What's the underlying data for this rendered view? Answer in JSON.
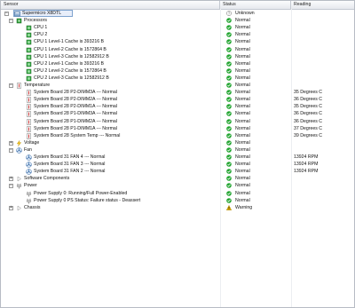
{
  "columns": {
    "sensor": "Sensor",
    "status": "Status",
    "reading": "Reading"
  },
  "colors": {
    "ok": "#23a532",
    "warn": "#e2b100",
    "unknown": "#6a6a6a"
  },
  "rows": [
    {
      "label": "Supermicro X8DTL",
      "level": 0,
      "expander": "−",
      "icon": "server-icon",
      "status": "Unknown",
      "status_icon": "unknown",
      "reading": "",
      "selected": true
    },
    {
      "label": "Processors",
      "level": 1,
      "expander": "−",
      "icon": "chip-icon",
      "status": "Normal",
      "status_icon": "ok",
      "reading": ""
    },
    {
      "label": "CPU 1",
      "level": 2,
      "icon": "cpu-icon",
      "status": "Normal",
      "status_icon": "ok",
      "reading": ""
    },
    {
      "label": "CPU 2",
      "level": 2,
      "icon": "cpu-icon",
      "status": "Normal",
      "status_icon": "ok",
      "reading": ""
    },
    {
      "label": "CPU 1 Level-1 Cache is 393216 B",
      "level": 2,
      "icon": "cpu-icon",
      "status": "Normal",
      "status_icon": "ok",
      "reading": ""
    },
    {
      "label": "CPU 1 Level-2 Cache is 1572864 B",
      "level": 2,
      "icon": "cpu-icon",
      "status": "Normal",
      "status_icon": "ok",
      "reading": ""
    },
    {
      "label": "CPU 1 Level-3 Cache is 12582912 B",
      "level": 2,
      "icon": "cpu-icon",
      "status": "Normal",
      "status_icon": "ok",
      "reading": ""
    },
    {
      "label": "CPU 2 Level-1 Cache is 393216 B",
      "level": 2,
      "icon": "cpu-icon",
      "status": "Normal",
      "status_icon": "ok",
      "reading": ""
    },
    {
      "label": "CPU 2 Level-2 Cache is 1572864 B",
      "level": 2,
      "icon": "cpu-icon",
      "status": "Normal",
      "status_icon": "ok",
      "reading": ""
    },
    {
      "label": "CPU 2 Level-3 Cache is 12582912 B",
      "level": 2,
      "icon": "cpu-icon",
      "status": "Normal",
      "status_icon": "ok",
      "reading": ""
    },
    {
      "label": "Temperature",
      "level": 1,
      "expander": "−",
      "icon": "thermometer-icon",
      "status": "Normal",
      "status_icon": "ok",
      "reading": ""
    },
    {
      "label": "System Board 28 P2-DIMM3A --- Normal",
      "level": 2,
      "icon": "thermometer-icon",
      "status": "Normal",
      "status_icon": "ok",
      "reading": "35 Degrees C"
    },
    {
      "label": "System Board 28 P2-DIMM2A --- Normal",
      "level": 2,
      "icon": "thermometer-icon",
      "status": "Normal",
      "status_icon": "ok",
      "reading": "36 Degrees C"
    },
    {
      "label": "System Board 28 P2-DIMM1A --- Normal",
      "level": 2,
      "icon": "thermometer-icon",
      "status": "Normal",
      "status_icon": "ok",
      "reading": "35 Degrees C"
    },
    {
      "label": "System Board 28 P1-DIMM3A --- Normal",
      "level": 2,
      "icon": "thermometer-icon",
      "status": "Normal",
      "status_icon": "ok",
      "reading": "36 Degrees C"
    },
    {
      "label": "System Board 28 P1-DIMM2A --- Normal",
      "level": 2,
      "icon": "thermometer-icon",
      "status": "Normal",
      "status_icon": "ok",
      "reading": "36 Degrees C"
    },
    {
      "label": "System Board 28 P1-DIMM1A --- Normal",
      "level": 2,
      "icon": "thermometer-icon",
      "status": "Normal",
      "status_icon": "ok",
      "reading": "37 Degrees C"
    },
    {
      "label": "System Board 28 System Temp --- Normal",
      "level": 2,
      "icon": "thermometer-icon",
      "status": "Normal",
      "status_icon": "ok",
      "reading": "39 Degrees C"
    },
    {
      "label": "Voltage",
      "level": 1,
      "expander": "+",
      "icon": "lightning-icon",
      "status": "Normal",
      "status_icon": "ok",
      "reading": ""
    },
    {
      "label": "Fan",
      "level": 1,
      "expander": "−",
      "icon": "fan-icon",
      "status": "Normal",
      "status_icon": "ok",
      "reading": ""
    },
    {
      "label": "System Board 31 FAN 4 --- Normal",
      "level": 2,
      "icon": "fan-icon",
      "status": "Normal",
      "status_icon": "ok",
      "reading": "13924 RPM"
    },
    {
      "label": "System Board 31 FAN 3 --- Normal",
      "level": 2,
      "icon": "fan-icon",
      "status": "Normal",
      "status_icon": "ok",
      "reading": "13924 RPM"
    },
    {
      "label": "System Board 31 FAN 2 --- Normal",
      "level": 2,
      "icon": "fan-icon",
      "status": "Normal",
      "status_icon": "ok",
      "reading": "13924 RPM"
    },
    {
      "label": "Software Components",
      "level": 1,
      "expander": "+",
      "icon": "component-icon",
      "status": "Normal",
      "status_icon": "ok",
      "reading": ""
    },
    {
      "label": "Power",
      "level": 1,
      "expander": "−",
      "icon": "power-icon",
      "status": "Normal",
      "status_icon": "ok",
      "reading": ""
    },
    {
      "label": "Power Supply 0: Running/Full Power-Enabled",
      "level": 2,
      "icon": "power-icon",
      "status": "Normal",
      "status_icon": "ok",
      "reading": ""
    },
    {
      "label": "Power Supply 0 PS Status: Failure status - Deassert",
      "level": 2,
      "icon": "power-icon",
      "status": "Normal",
      "status_icon": "ok",
      "reading": ""
    },
    {
      "label": "Chassis",
      "level": 1,
      "expander": "+",
      "icon": "chassis-icon",
      "status": "Warning",
      "status_icon": "warn",
      "reading": ""
    }
  ]
}
